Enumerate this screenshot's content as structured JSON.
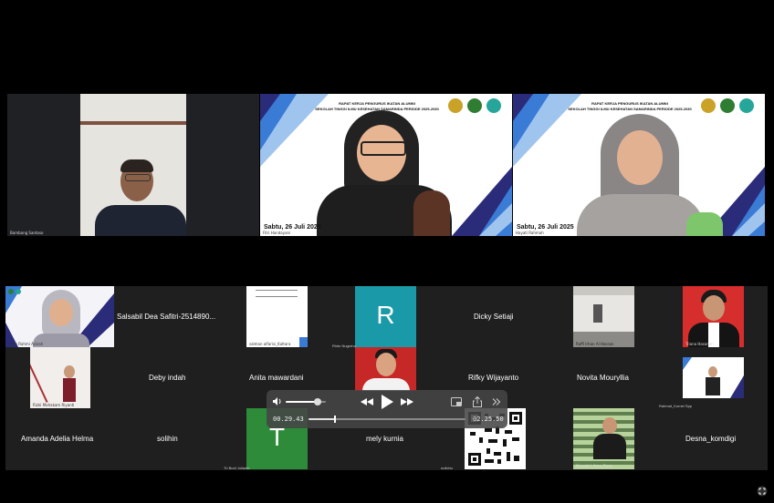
{
  "top_tiles": [
    {
      "name": "Bambang Santoso"
    },
    {
      "name": "Fitri Handayani",
      "banner_title": "RAPAT KERJA PENGURUS IKATAN ALUMNI\nSEKOLAH TINGGI ILMU KESEHATAN SAMARINDA PERIODE 2025-2030",
      "date": "Sabtu, 26 Juli 2025"
    },
    {
      "name": "Hayati Rahmah",
      "banner_title": "RAPAT KERJA PENGURUS IKATAN ALUMNI\nSEKOLAH TINGGI ILMU KESEHATAN SAMARINDA PERIODE 2025-2030",
      "date": "Sabtu, 26 Juli 2025"
    }
  ],
  "grid": {
    "row1": [
      {
        "name": "Aulia Rahmi Azizah",
        "type": "video"
      },
      {
        "name": "Salsabil Dea Safitri-2514890...",
        "type": "text"
      },
      {
        "name": "salman alfarisi_Kaltara",
        "type": "video"
      },
      {
        "letter": "R",
        "name": "Rinto Nugroho",
        "color": "#1a9aa8",
        "type": "letter"
      },
      {
        "name": "Dicky Setiaji",
        "type": "text"
      },
      {
        "name": "Raffi Irhan Al Hassan",
        "type": "video"
      },
      {
        "name": "Triana Hasanah",
        "type": "video"
      }
    ],
    "row2": [
      {
        "name": "Rizki Mahakam Riyanti",
        "type": "video"
      },
      {
        "name": "Deby indah",
        "type": "text"
      },
      {
        "name": "Anita mawardani",
        "type": "text"
      },
      {
        "name": "",
        "type": "video"
      },
      {
        "name": "Rifky Wijayanto",
        "type": "text"
      },
      {
        "name": "Novita Mouryllia",
        "type": "text"
      },
      {
        "name": "Rahmat_Kornel Spp",
        "type": "video"
      }
    ],
    "row3": [
      {
        "name": "Amanda Adelia Helma",
        "type": "text"
      },
      {
        "name": "solihin",
        "type": "text"
      },
      {
        "letter": "T",
        "name": "Tri Budi Julianto",
        "color": "#2e8b3a",
        "type": "letter"
      },
      {
        "name": "mely kurnia",
        "type": "text"
      },
      {
        "name": "nufichu",
        "type": "qr"
      },
      {
        "name": "Musabiri_Ama_Farm",
        "type": "video"
      },
      {
        "name": "Desna_komdigi",
        "type": "text"
      }
    ]
  },
  "player": {
    "current_time": "00.29.43",
    "remaining_time": "02.25.50",
    "volume": 0.8,
    "progress": 0.17,
    "icons": [
      "volume-icon",
      "rewind-icon",
      "play-icon",
      "fast-forward-icon",
      "pip-icon",
      "share-icon",
      "chevrons-icon"
    ]
  },
  "colors": {
    "accent_blue": "#1565c0",
    "banner_navy": "#2a2c7a"
  }
}
